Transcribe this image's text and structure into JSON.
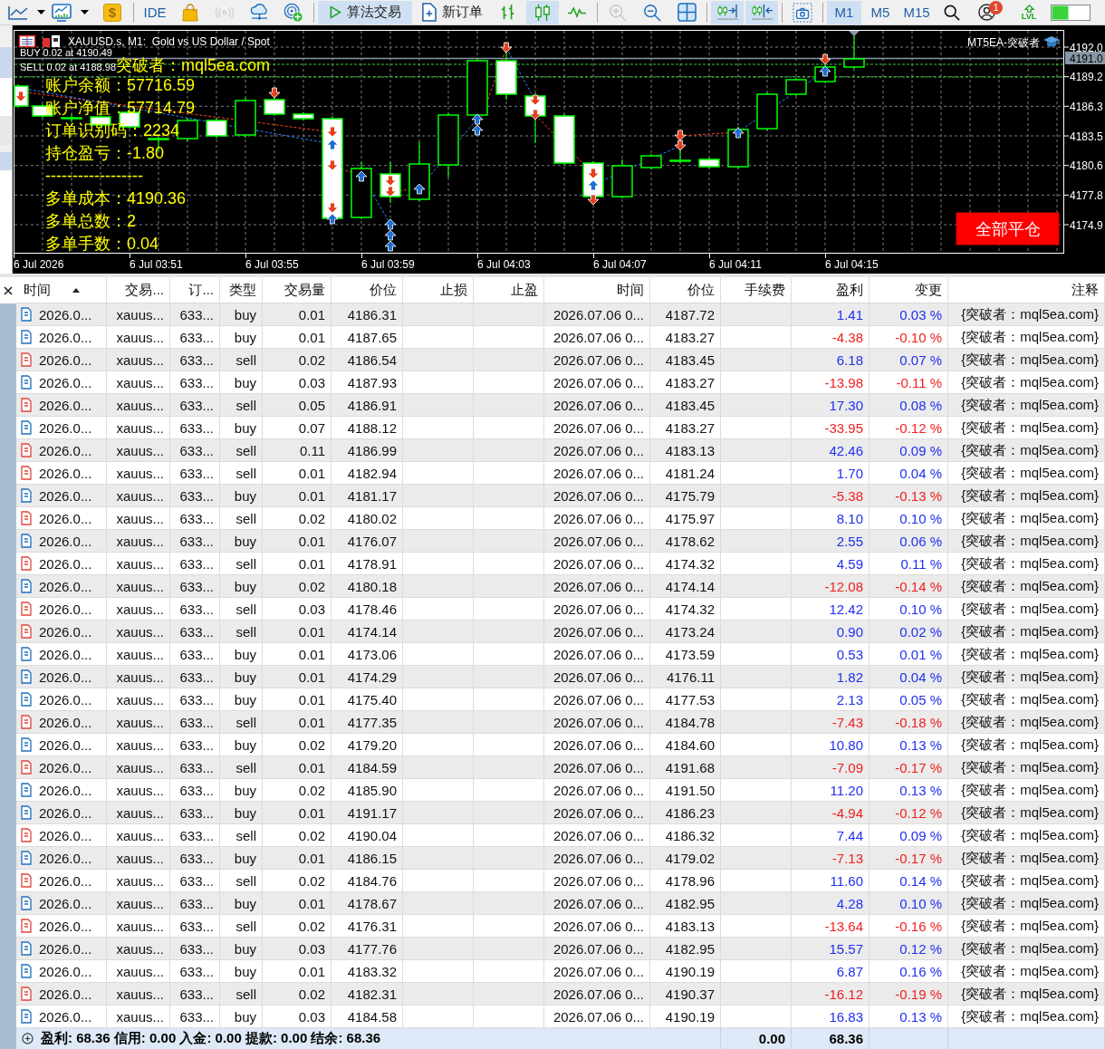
{
  "toolbar": [
    [
      {
        "kind": "line-chart",
        "dropdown": true,
        "selected": false,
        "disabled": false
      },
      {
        "kind": "chart-template",
        "dropdown": true,
        "selected": false,
        "disabled": false
      },
      {
        "kind": "coin",
        "label": "$",
        "dropdown": false,
        "selected": false,
        "disabled": false
      }
    ],
    [
      {
        "kind": "text",
        "label": "IDE",
        "dropdown": false,
        "selected": false,
        "disabled": false
      },
      {
        "kind": "bag",
        "dropdown": false,
        "selected": false,
        "disabled": false
      },
      {
        "kind": "signal",
        "dropdown": false,
        "selected": false,
        "disabled": true
      },
      {
        "kind": "cloud",
        "dropdown": false,
        "selected": false,
        "disabled": false
      },
      {
        "kind": "radar-plus",
        "dropdown": false,
        "selected": false,
        "disabled": false
      }
    ],
    [
      {
        "kind": "play",
        "label": "算法交易",
        "dropdown": false,
        "selected": true,
        "disabled": false
      },
      {
        "kind": "doc-plus",
        "label": "新订单",
        "dropdown": false,
        "selected": false,
        "disabled": false
      },
      {
        "kind": "bars",
        "dropdown": false,
        "selected": false,
        "disabled": false
      },
      {
        "kind": "candles",
        "dropdown": false,
        "selected": true,
        "disabled": false
      },
      {
        "kind": "line",
        "dropdown": false,
        "selected": false,
        "disabled": false
      }
    ],
    [
      {
        "kind": "zoom-in",
        "dropdown": false,
        "selected": false,
        "disabled": true
      },
      {
        "kind": "zoom-out",
        "dropdown": false,
        "selected": false,
        "disabled": false
      },
      {
        "kind": "grid",
        "dropdown": false,
        "selected": false,
        "disabled": false
      }
    ],
    [
      {
        "kind": "scroll-right",
        "dropdown": false,
        "selected": true,
        "disabled": false
      },
      {
        "kind": "shift-left",
        "dropdown": false,
        "selected": true,
        "disabled": false
      }
    ],
    [
      {
        "kind": "camera",
        "dropdown": false,
        "selected": false,
        "disabled": false
      }
    ],
    [
      {
        "kind": "text",
        "label": "M1",
        "dropdown": false,
        "selected": true,
        "disabled": false
      },
      {
        "kind": "text",
        "label": "M5",
        "dropdown": false,
        "selected": false,
        "disabled": false
      },
      {
        "kind": "text",
        "label": "M15",
        "dropdown": false,
        "selected": false,
        "disabled": false
      },
      {
        "kind": "search",
        "dropdown": false,
        "selected": false,
        "disabled": false
      },
      {
        "kind": "account",
        "badge": "1",
        "dropdown": false,
        "selected": false,
        "disabled": false
      },
      {
        "kind": "lvl",
        "label": "LVL",
        "dropdown": false,
        "selected": false,
        "disabled": false
      },
      {
        "kind": "meter",
        "dropdown": false,
        "selected": false,
        "disabled": false
      }
    ]
  ],
  "chart": {
    "title": "XAUUSD.s, M1:  Gold vs US Dollar / Spot",
    "ea_name": "MT5EA-突破者",
    "position_lines": [
      "BUY 0.02 at 4190.49",
      "SELL 0.02 at 4188.98"
    ],
    "brand": "突破者：mql5ea.com",
    "stats": [
      "账户余额：57716.59",
      "账户净值：57714.79",
      "订单识别码：2234",
      "持仓盈亏：-1.80",
      "------------------",
      "多单成本：4190.36",
      "多单总数：2",
      "多单手数：0.04"
    ],
    "close_all_button": "全部平仓",
    "price_ticks": [
      "4192.0",
      "4189.2",
      "4186.3",
      "4183.5",
      "4180.6",
      "4177.8",
      "4174.9"
    ],
    "current_price": "4191.0",
    "time_labels": [
      "6 Jul 2026",
      "6 Jul 03:51",
      "6 Jul 03:55",
      "6 Jul 03:59",
      "6 Jul 04:03",
      "6 Jul 04:07",
      "6 Jul 04:11",
      "6 Jul 04:15"
    ]
  },
  "table": {
    "columns": [
      {
        "label": "时间",
        "sorted": true
      },
      {
        "label": "交易...",
        "sorted": false
      },
      {
        "label": "订...",
        "sorted": false
      },
      {
        "label": "类型",
        "sorted": false
      },
      {
        "label": "交易量",
        "sorted": false
      },
      {
        "label": "价位",
        "sorted": false
      },
      {
        "label": "止损",
        "sorted": false
      },
      {
        "label": "止盈",
        "sorted": false
      },
      {
        "label": "时间",
        "sorted": false
      },
      {
        "label": "价位",
        "sorted": false
      },
      {
        "label": "手续费",
        "sorted": false
      },
      {
        "label": "盈利",
        "sorted": false
      },
      {
        "label": "变更",
        "sorted": false
      },
      {
        "label": "注释",
        "sorted": false
      }
    ],
    "rows": [
      {
        "kind": "buy",
        "time": "2026.0...",
        "symbol": "xauus...",
        "order": "633...",
        "type": "buy",
        "volume": "0.01",
        "price": "4186.31",
        "close_time": "2026.07.06 0...",
        "close_price": "4187.72",
        "profit": "1.41",
        "change": "0.03 %",
        "loss": false,
        "comment": "{突破者：mql5ea.com}"
      },
      {
        "kind": "buy",
        "time": "2026.0...",
        "symbol": "xauus...",
        "order": "633...",
        "type": "buy",
        "volume": "0.01",
        "price": "4187.65",
        "close_time": "2026.07.06 0...",
        "close_price": "4183.27",
        "profit": "-4.38",
        "change": "-0.10 %",
        "loss": true,
        "comment": "{突破者：mql5ea.com}"
      },
      {
        "kind": "sell",
        "time": "2026.0...",
        "symbol": "xauus...",
        "order": "633...",
        "type": "sell",
        "volume": "0.02",
        "price": "4186.54",
        "close_time": "2026.07.06 0...",
        "close_price": "4183.45",
        "profit": "6.18",
        "change": "0.07 %",
        "loss": false,
        "comment": "{突破者：mql5ea.com}"
      },
      {
        "kind": "buy",
        "time": "2026.0...",
        "symbol": "xauus...",
        "order": "633...",
        "type": "buy",
        "volume": "0.03",
        "price": "4187.93",
        "close_time": "2026.07.06 0...",
        "close_price": "4183.27",
        "profit": "-13.98",
        "change": "-0.11 %",
        "loss": true,
        "comment": "{突破者：mql5ea.com}"
      },
      {
        "kind": "sell",
        "time": "2026.0...",
        "symbol": "xauus...",
        "order": "633...",
        "type": "sell",
        "volume": "0.05",
        "price": "4186.91",
        "close_time": "2026.07.06 0...",
        "close_price": "4183.45",
        "profit": "17.30",
        "change": "0.08 %",
        "loss": false,
        "comment": "{突破者：mql5ea.com}"
      },
      {
        "kind": "buy",
        "time": "2026.0...",
        "symbol": "xauus...",
        "order": "633...",
        "type": "buy",
        "volume": "0.07",
        "price": "4188.12",
        "close_time": "2026.07.06 0...",
        "close_price": "4183.27",
        "profit": "-33.95",
        "change": "-0.12 %",
        "loss": true,
        "comment": "{突破者：mql5ea.com}"
      },
      {
        "kind": "sell",
        "time": "2026.0...",
        "symbol": "xauus...",
        "order": "633...",
        "type": "sell",
        "volume": "0.11",
        "price": "4186.99",
        "close_time": "2026.07.06 0...",
        "close_price": "4183.13",
        "profit": "42.46",
        "change": "0.09 %",
        "loss": false,
        "comment": "{突破者：mql5ea.com}"
      },
      {
        "kind": "sell",
        "time": "2026.0...",
        "symbol": "xauus...",
        "order": "633...",
        "type": "sell",
        "volume": "0.01",
        "price": "4182.94",
        "close_time": "2026.07.06 0...",
        "close_price": "4181.24",
        "profit": "1.70",
        "change": "0.04 %",
        "loss": false,
        "comment": "{突破者：mql5ea.com}"
      },
      {
        "kind": "buy",
        "time": "2026.0...",
        "symbol": "xauus...",
        "order": "633...",
        "type": "buy",
        "volume": "0.01",
        "price": "4181.17",
        "close_time": "2026.07.06 0...",
        "close_price": "4175.79",
        "profit": "-5.38",
        "change": "-0.13 %",
        "loss": true,
        "comment": "{突破者：mql5ea.com}"
      },
      {
        "kind": "sell",
        "time": "2026.0...",
        "symbol": "xauus...",
        "order": "633...",
        "type": "sell",
        "volume": "0.02",
        "price": "4180.02",
        "close_time": "2026.07.06 0...",
        "close_price": "4175.97",
        "profit": "8.10",
        "change": "0.10 %",
        "loss": false,
        "comment": "{突破者：mql5ea.com}"
      },
      {
        "kind": "buy",
        "time": "2026.0...",
        "symbol": "xauus...",
        "order": "633...",
        "type": "buy",
        "volume": "0.01",
        "price": "4176.07",
        "close_time": "2026.07.06 0...",
        "close_price": "4178.62",
        "profit": "2.55",
        "change": "0.06 %",
        "loss": false,
        "comment": "{突破者：mql5ea.com}"
      },
      {
        "kind": "sell",
        "time": "2026.0...",
        "symbol": "xauus...",
        "order": "633...",
        "type": "sell",
        "volume": "0.01",
        "price": "4178.91",
        "close_time": "2026.07.06 0...",
        "close_price": "4174.32",
        "profit": "4.59",
        "change": "0.11 %",
        "loss": false,
        "comment": "{突破者：mql5ea.com}"
      },
      {
        "kind": "buy",
        "time": "2026.0...",
        "symbol": "xauus...",
        "order": "633...",
        "type": "buy",
        "volume": "0.02",
        "price": "4180.18",
        "close_time": "2026.07.06 0...",
        "close_price": "4174.14",
        "profit": "-12.08",
        "change": "-0.14 %",
        "loss": true,
        "comment": "{突破者：mql5ea.com}"
      },
      {
        "kind": "sell",
        "time": "2026.0...",
        "symbol": "xauus...",
        "order": "633...",
        "type": "sell",
        "volume": "0.03",
        "price": "4178.46",
        "close_time": "2026.07.06 0...",
        "close_price": "4174.32",
        "profit": "12.42",
        "change": "0.10 %",
        "loss": false,
        "comment": "{突破者：mql5ea.com}"
      },
      {
        "kind": "sell",
        "time": "2026.0...",
        "symbol": "xauus...",
        "order": "633...",
        "type": "sell",
        "volume": "0.01",
        "price": "4174.14",
        "close_time": "2026.07.06 0...",
        "close_price": "4173.24",
        "profit": "0.90",
        "change": "0.02 %",
        "loss": false,
        "comment": "{突破者：mql5ea.com}"
      },
      {
        "kind": "buy",
        "time": "2026.0...",
        "symbol": "xauus...",
        "order": "633...",
        "type": "buy",
        "volume": "0.01",
        "price": "4173.06",
        "close_time": "2026.07.06 0...",
        "close_price": "4173.59",
        "profit": "0.53",
        "change": "0.01 %",
        "loss": false,
        "comment": "{突破者：mql5ea.com}"
      },
      {
        "kind": "buy",
        "time": "2026.0...",
        "symbol": "xauus...",
        "order": "633...",
        "type": "buy",
        "volume": "0.01",
        "price": "4174.29",
        "close_time": "2026.07.06 0...",
        "close_price": "4176.11",
        "profit": "1.82",
        "change": "0.04 %",
        "loss": false,
        "comment": "{突破者：mql5ea.com}"
      },
      {
        "kind": "buy",
        "time": "2026.0...",
        "symbol": "xauus...",
        "order": "633...",
        "type": "buy",
        "volume": "0.01",
        "price": "4175.40",
        "close_time": "2026.07.06 0...",
        "close_price": "4177.53",
        "profit": "2.13",
        "change": "0.05 %",
        "loss": false,
        "comment": "{突破者：mql5ea.com}"
      },
      {
        "kind": "sell",
        "time": "2026.0...",
        "symbol": "xauus...",
        "order": "633...",
        "type": "sell",
        "volume": "0.01",
        "price": "4177.35",
        "close_time": "2026.07.06 0...",
        "close_price": "4184.78",
        "profit": "-7.43",
        "change": "-0.18 %",
        "loss": true,
        "comment": "{突破者：mql5ea.com}"
      },
      {
        "kind": "buy",
        "time": "2026.0...",
        "symbol": "xauus...",
        "order": "633...",
        "type": "buy",
        "volume": "0.02",
        "price": "4179.20",
        "close_time": "2026.07.06 0...",
        "close_price": "4184.60",
        "profit": "10.80",
        "change": "0.13 %",
        "loss": false,
        "comment": "{突破者：mql5ea.com}"
      },
      {
        "kind": "sell",
        "time": "2026.0...",
        "symbol": "xauus...",
        "order": "633...",
        "type": "sell",
        "volume": "0.01",
        "price": "4184.59",
        "close_time": "2026.07.06 0...",
        "close_price": "4191.68",
        "profit": "-7.09",
        "change": "-0.17 %",
        "loss": true,
        "comment": "{突破者：mql5ea.com}"
      },
      {
        "kind": "buy",
        "time": "2026.0...",
        "symbol": "xauus...",
        "order": "633...",
        "type": "buy",
        "volume": "0.02",
        "price": "4185.90",
        "close_time": "2026.07.06 0...",
        "close_price": "4191.50",
        "profit": "11.20",
        "change": "0.13 %",
        "loss": false,
        "comment": "{突破者：mql5ea.com}"
      },
      {
        "kind": "buy",
        "time": "2026.0...",
        "symbol": "xauus...",
        "order": "633...",
        "type": "buy",
        "volume": "0.01",
        "price": "4191.17",
        "close_time": "2026.07.06 0...",
        "close_price": "4186.23",
        "profit": "-4.94",
        "change": "-0.12 %",
        "loss": true,
        "comment": "{突破者：mql5ea.com}"
      },
      {
        "kind": "sell",
        "time": "2026.0...",
        "symbol": "xauus...",
        "order": "633...",
        "type": "sell",
        "volume": "0.02",
        "price": "4190.04",
        "close_time": "2026.07.06 0...",
        "close_price": "4186.32",
        "profit": "7.44",
        "change": "0.09 %",
        "loss": false,
        "comment": "{突破者：mql5ea.com}"
      },
      {
        "kind": "buy",
        "time": "2026.0...",
        "symbol": "xauus...",
        "order": "633...",
        "type": "buy",
        "volume": "0.01",
        "price": "4186.15",
        "close_time": "2026.07.06 0...",
        "close_price": "4179.02",
        "profit": "-7.13",
        "change": "-0.17 %",
        "loss": true,
        "comment": "{突破者：mql5ea.com}"
      },
      {
        "kind": "sell",
        "time": "2026.0...",
        "symbol": "xauus...",
        "order": "633...",
        "type": "sell",
        "volume": "0.02",
        "price": "4184.76",
        "close_time": "2026.07.06 0...",
        "close_price": "4178.96",
        "profit": "11.60",
        "change": "0.14 %",
        "loss": false,
        "comment": "{突破者：mql5ea.com}"
      },
      {
        "kind": "buy",
        "time": "2026.0...",
        "symbol": "xauus...",
        "order": "633...",
        "type": "buy",
        "volume": "0.01",
        "price": "4178.67",
        "close_time": "2026.07.06 0...",
        "close_price": "4182.95",
        "profit": "4.28",
        "change": "0.10 %",
        "loss": false,
        "comment": "{突破者：mql5ea.com}"
      },
      {
        "kind": "sell",
        "time": "2026.0...",
        "symbol": "xauus...",
        "order": "633...",
        "type": "sell",
        "volume": "0.02",
        "price": "4176.31",
        "close_time": "2026.07.06 0...",
        "close_price": "4183.13",
        "profit": "-13.64",
        "change": "-0.16 %",
        "loss": true,
        "comment": "{突破者：mql5ea.com}"
      },
      {
        "kind": "buy",
        "time": "2026.0...",
        "symbol": "xauus...",
        "order": "633...",
        "type": "buy",
        "volume": "0.03",
        "price": "4177.76",
        "close_time": "2026.07.06 0...",
        "close_price": "4182.95",
        "profit": "15.57",
        "change": "0.12 %",
        "loss": false,
        "comment": "{突破者：mql5ea.com}"
      },
      {
        "kind": "buy",
        "time": "2026.0...",
        "symbol": "xauus...",
        "order": "633...",
        "type": "buy",
        "volume": "0.01",
        "price": "4183.32",
        "close_time": "2026.07.06 0...",
        "close_price": "4190.19",
        "profit": "6.87",
        "change": "0.16 %",
        "loss": false,
        "comment": "{突破者：mql5ea.com}"
      },
      {
        "kind": "sell",
        "time": "2026.0...",
        "symbol": "xauus...",
        "order": "633...",
        "type": "sell",
        "volume": "0.02",
        "price": "4182.31",
        "close_time": "2026.07.06 0...",
        "close_price": "4190.37",
        "profit": "-16.12",
        "change": "-0.19 %",
        "loss": true,
        "comment": "{突破者：mql5ea.com}"
      },
      {
        "kind": "buy",
        "time": "2026.0...",
        "symbol": "xauus...",
        "order": "633...",
        "type": "buy",
        "volume": "0.03",
        "price": "4184.58",
        "close_time": "2026.07.06 0...",
        "close_price": "4190.19",
        "profit": "16.83",
        "change": "0.13 %",
        "loss": false,
        "comment": "{突破者：mql5ea.com}"
      }
    ],
    "footer": {
      "summary": "盈利: 68.36 信用: 0.00 入金: 0.00 提款: 0.00 结余: 68.36",
      "commission": "0.00",
      "profit": "68.36"
    }
  }
}
